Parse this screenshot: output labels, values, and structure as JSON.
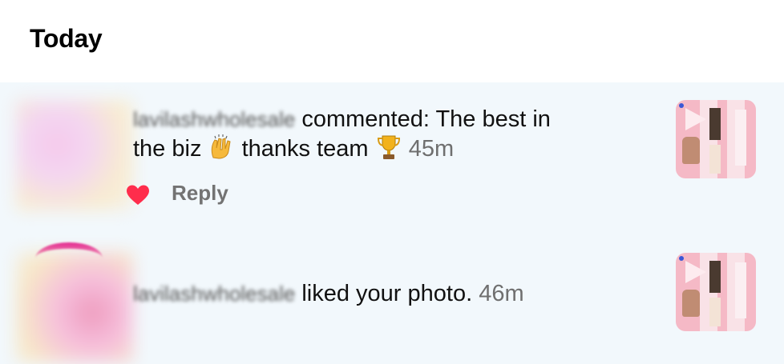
{
  "header": {
    "title": "Today"
  },
  "notifications": [
    {
      "username": "lavilashwholesale",
      "action_text": "commented: The best in",
      "line2_text_a": "the biz",
      "line2_text_b": "thanks team",
      "time": "45m",
      "reply_label": "Reply",
      "liked": true,
      "emojis": [
        "raising-hands-emoji",
        "trophy-emoji"
      ]
    },
    {
      "username": "lavilashwholesale",
      "action_text": "liked your photo.",
      "time": "46m"
    }
  ],
  "colors": {
    "list_bg": "#f2f8fc",
    "heart": "#ff2d4c",
    "muted_text": "#737373",
    "thumb_bg": "#f5b9c6"
  }
}
